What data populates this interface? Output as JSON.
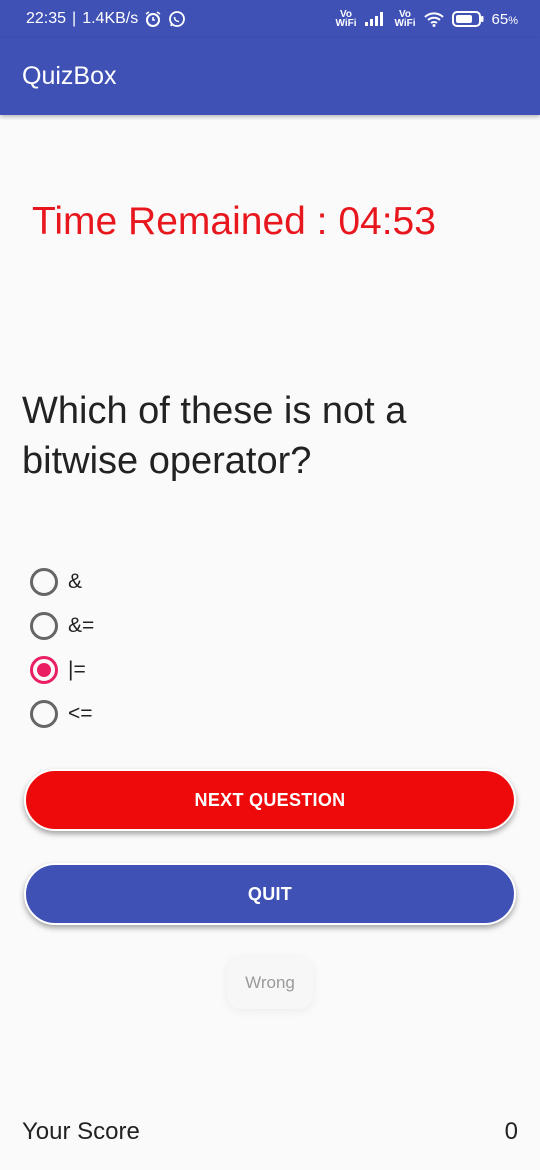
{
  "status_bar": {
    "time": "22:35",
    "separator": "|",
    "net_speed": "1.4KB/s",
    "volte1_top": "Vo",
    "volte1_bottom": "WiFi",
    "volte2_top": "Vo",
    "volte2_bottom": "WiFi",
    "battery": "65",
    "battery_unit": "%",
    "icons": [
      "alarm-icon",
      "whatsapp-icon",
      "signal-icon",
      "wifi-icon",
      "battery-icon"
    ]
  },
  "app_bar": {
    "title": "QuizBox"
  },
  "timer": {
    "text": "Time Remained : 04:53"
  },
  "question": {
    "text": "Which of these is not a bitwise operator?"
  },
  "options": [
    {
      "label": "&",
      "selected": false
    },
    {
      "label": "&=",
      "selected": false
    },
    {
      "label": "|=",
      "selected": true
    },
    {
      "label": "<=",
      "selected": false
    }
  ],
  "buttons": {
    "next_label": "NEXT QUESTION",
    "quit_label": "QUIT"
  },
  "toast": {
    "text": "Wrong"
  },
  "score": {
    "label": "Your Score",
    "value": "0"
  },
  "colors": {
    "primary": "#3f51b5",
    "timer": "#e8171e",
    "next_button": "#ee0a0a",
    "radio_accent": "#e91e63"
  }
}
